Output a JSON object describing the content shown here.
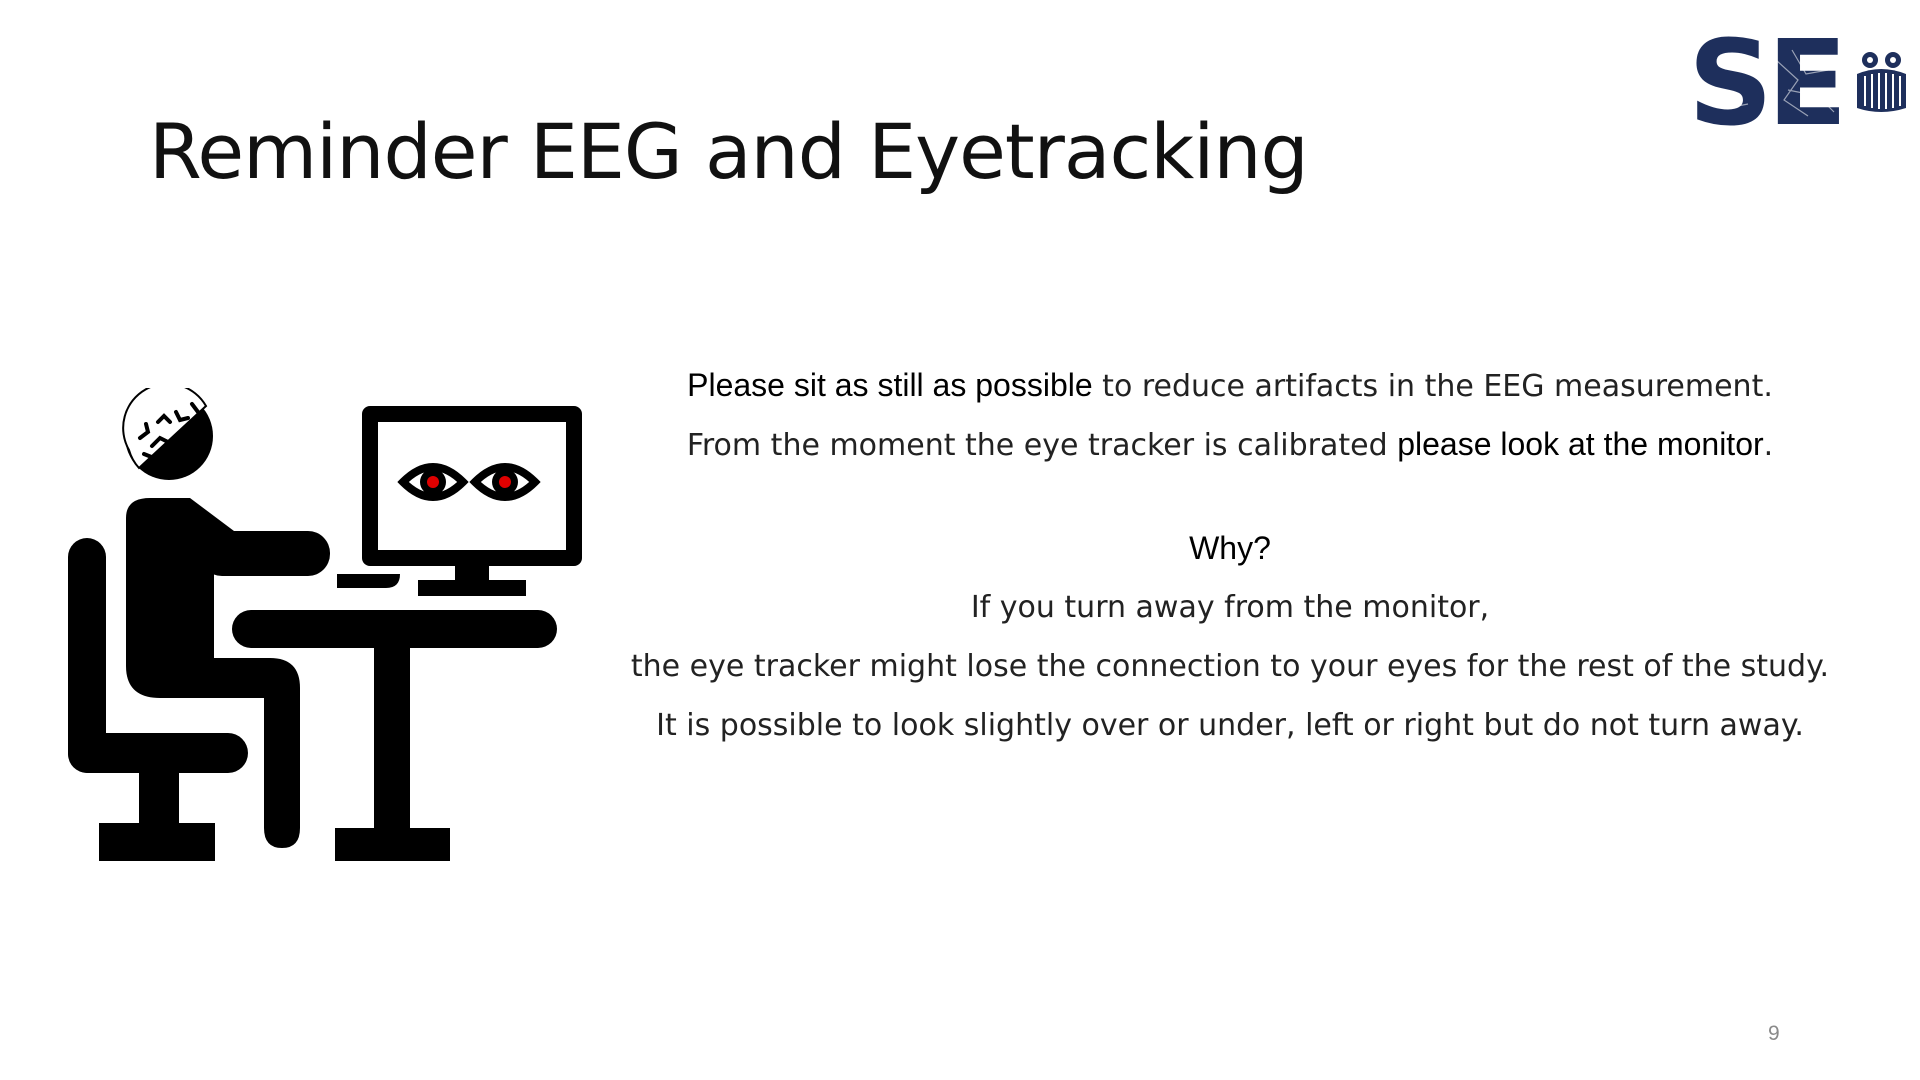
{
  "slide": {
    "title": "Reminder EEG and Eyetracking",
    "page_number": "9"
  },
  "logo": {
    "letters": "SE",
    "color": "#1e2f5c"
  },
  "illustration": {
    "icon": "person-at-computer-with-eeg-cap-icon",
    "eye_pupil_color": "#e00000"
  },
  "body": {
    "line1_bold": "Please sit as still as possible",
    "line1_rest": " to reduce artifacts in the EEG measurement.",
    "line2_start": "From the moment the eye tracker is calibrated ",
    "line2_bold": "please look at the monitor",
    "line2_end": ".",
    "why_heading": "Why?",
    "line4": "If you turn away from the monitor,",
    "line5": "the eye tracker might lose the connection to your eyes for the rest of the study.",
    "line6": "It is possible to look slightly over or under, left or right but do not turn away."
  }
}
